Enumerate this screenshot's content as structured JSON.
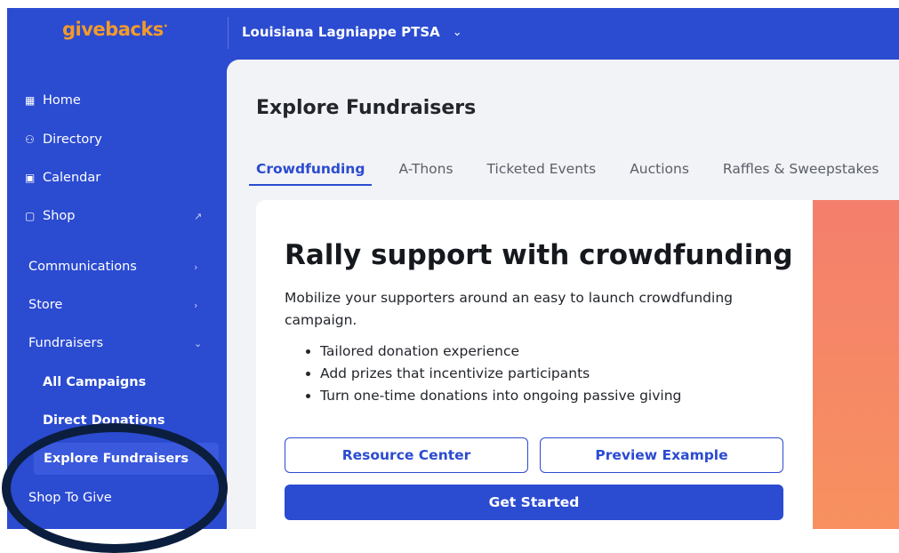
{
  "colors": {
    "brand_blue": "#2b4bd1",
    "logo_orange": "#f39a2c",
    "promo_coral": "#f47f6c"
  },
  "topbar": {
    "logo": "givebacks",
    "org_name": "Louisiana Lagniappe PTSA"
  },
  "sidebar": {
    "items": [
      {
        "label": "Home",
        "icon": "home-grid-icon"
      },
      {
        "label": "Directory",
        "icon": "people-icon"
      },
      {
        "label": "Calendar",
        "icon": "calendar-icon"
      },
      {
        "label": "Shop",
        "icon": "shopping-bag-icon",
        "trail_icon": "external-link-icon"
      }
    ],
    "sections": [
      {
        "label": "Communications",
        "state": "collapsed"
      },
      {
        "label": "Store",
        "state": "collapsed"
      },
      {
        "label": "Fundraisers",
        "state": "expanded"
      }
    ],
    "fundraiser_subitems": [
      "All Campaigns",
      "Direct Donations",
      "Explore Fundraisers"
    ],
    "active_item": "Explore Fundraisers",
    "after_sections": [
      {
        "label": "Shop To Give"
      }
    ]
  },
  "main": {
    "title": "Explore Fundraisers",
    "tabs": [
      "Crowdfunding",
      "A-Thons",
      "Ticketed Events",
      "Auctions",
      "Raffles & Sweepstakes"
    ],
    "active_tab": "Crowdfunding",
    "card": {
      "title": "Rally support with crowdfunding",
      "description": "Mobilize your supporters around an easy to launch crowdfunding campaign.",
      "bullets": [
        "Tailored donation experience",
        "Add prizes that incentivize participants",
        "Turn one-time donations into ongoing passive giving"
      ],
      "resource_button": "Resource Center",
      "preview_button": "Preview Example",
      "start_button": "Get Started"
    }
  }
}
